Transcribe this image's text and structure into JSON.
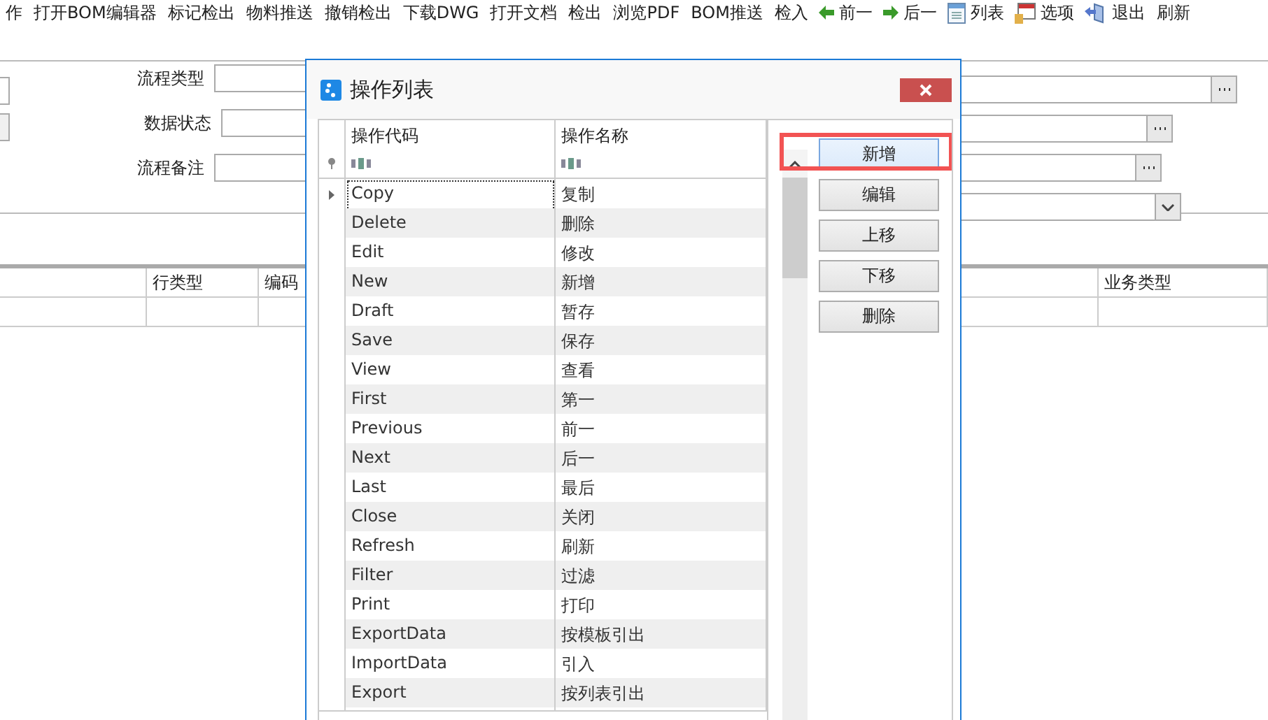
{
  "toolbar": [
    {
      "label": "作"
    },
    {
      "label": "打开BOM编辑器"
    },
    {
      "label": "标记检出"
    },
    {
      "label": "物料推送"
    },
    {
      "label": "撤销检出"
    },
    {
      "label": "下载DWG"
    },
    {
      "label": "打开文档"
    },
    {
      "label": "检出"
    },
    {
      "label": "浏览PDF"
    },
    {
      "label": "BOM推送"
    },
    {
      "label": "检入"
    },
    {
      "label": "前一",
      "kind": "back"
    },
    {
      "label": "后一",
      "kind": "forward"
    },
    {
      "label": "列表",
      "kind": "list"
    },
    {
      "label": "选项",
      "kind": "options"
    },
    {
      "label": "退出",
      "kind": "exit"
    },
    {
      "label": "刷新"
    }
  ],
  "form": {
    "left_fields": [
      {
        "label": "流程类型"
      },
      {
        "label": "数据状态"
      },
      {
        "label": "流程备注"
      }
    ],
    "right_fields": [
      {
        "kind": "lookup"
      },
      {
        "kind": "lookup"
      },
      {
        "kind": "lookup"
      },
      {
        "kind": "dropdown"
      }
    ]
  },
  "grid": {
    "columns": [
      "行类型",
      "编码",
      "业务类型"
    ]
  },
  "dialog": {
    "title": "操作列表",
    "columns": [
      "操作代码",
      "操作名称"
    ],
    "rows": [
      {
        "code": "Copy",
        "name": "复制",
        "selected": true
      },
      {
        "code": "Delete",
        "name": "删除",
        "selected": false
      },
      {
        "code": "Edit",
        "name": "修改",
        "selected": false
      },
      {
        "code": "New",
        "name": "新增",
        "selected": false
      },
      {
        "code": "Draft",
        "name": "暂存",
        "selected": false
      },
      {
        "code": "Save",
        "name": "保存",
        "selected": false
      },
      {
        "code": "View",
        "name": "查看",
        "selected": false
      },
      {
        "code": "First",
        "name": "第一",
        "selected": false
      },
      {
        "code": "Previous",
        "name": "前一",
        "selected": false
      },
      {
        "code": "Next",
        "name": "后一",
        "selected": false
      },
      {
        "code": "Last",
        "name": "最后",
        "selected": false
      },
      {
        "code": "Close",
        "name": "关闭",
        "selected": false
      },
      {
        "code": "Refresh",
        "name": "刷新",
        "selected": false
      },
      {
        "code": "Filter",
        "name": "过滤",
        "selected": false
      },
      {
        "code": "Print",
        "name": "打印",
        "selected": false
      },
      {
        "code": "ExportData",
        "name": "按模板引出",
        "selected": false
      },
      {
        "code": "ImportData",
        "name": "引入",
        "selected": false
      },
      {
        "code": "Export",
        "name": "按列表引出",
        "selected": false
      }
    ],
    "buttons": [
      {
        "label": "新增",
        "focused": true,
        "highlighted": true
      },
      {
        "label": "编辑",
        "focused": false,
        "highlighted": false
      },
      {
        "label": "上移",
        "focused": false,
        "highlighted": false
      },
      {
        "label": "下移",
        "focused": false,
        "highlighted": false
      },
      {
        "label": "删除",
        "focused": false,
        "highlighted": false
      }
    ]
  }
}
